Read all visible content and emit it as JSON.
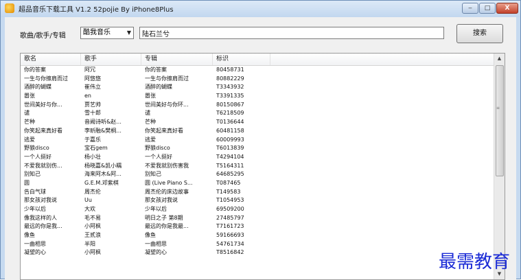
{
  "window": {
    "title": "超品音乐下载工具 V1.2 52pojie By iPhone8Plus",
    "minimize_glyph": "‒",
    "maximize_glyph": "□",
    "close_glyph": "X"
  },
  "search": {
    "label": "歌曲/歌手/专辑",
    "source_selected": "酷我音乐",
    "query_value": "陆石兰兮",
    "button_label": "搜索"
  },
  "table": {
    "columns": [
      "歌名",
      "歌手",
      "专辑",
      "标识"
    ],
    "rows": [
      [
        "你的答案",
        "阿冗",
        "你的答案",
        "80458731"
      ],
      [
        "一生与你擦肩而过",
        "阿悠悠",
        "一生与你擦肩而过",
        "80882229"
      ],
      [
        "酒醉的蝴蝶",
        "崔伟立",
        "酒醉的蝴蝶",
        "T3343932"
      ],
      [
        "嚣张",
        "en",
        "嚣张",
        "T3391335"
      ],
      [
        "世间美好与你...",
        "贾艺帅",
        "世间美好与你环...",
        "80150867"
      ],
      [
        "谴",
        "雪十郎",
        "谴",
        "T6218509"
      ],
      [
        "芒种",
        "音阙诗听&赵...",
        "芒种",
        "T0136644"
      ],
      [
        "你笑起来真好看",
        "李昕融&樊桐...",
        "你笑起来真好看",
        "60481158"
      ],
      [
        "逃爱",
        "于嘉乐",
        "逃爱",
        "60009993"
      ],
      [
        "野狼disco",
        "宝石gem",
        "野狼disco",
        "T6013839"
      ],
      [
        "一个人挺好",
        "杨小壮",
        "一个人挺好",
        "T4294104"
      ],
      [
        "不爱我就别伤...",
        "杨晓嘉&凯小糯",
        "不爱我就别伤害我",
        "T5164311"
      ],
      [
        "别知己",
        "海来阿木&阿...",
        "别知己",
        "64685295"
      ],
      [
        "圆",
        "G.E.M.邓紫棋",
        "圆 (Live Piano S...",
        "T087465"
      ],
      [
        "告白气球",
        "周杰伦",
        "周杰伦的床边故事",
        "T149583"
      ],
      [
        "那女孩对我说",
        "Uu",
        "那女孩对我说",
        "T1054953"
      ],
      [
        "少年以后",
        "大欢",
        "少年以后",
        "69509200"
      ],
      [
        "像我这样的人",
        "毛不易",
        "明日之子 第8期",
        "27485797"
      ],
      [
        "最远的你是我...",
        "小阿枫",
        "最远的你是我最...",
        "T7161723"
      ],
      [
        "像鱼",
        "王贰浪",
        "像鱼",
        "59166693"
      ],
      [
        "一曲相思",
        "半阳",
        "一曲相思",
        "54761734"
      ],
      [
        "凝望的心",
        "小阿枫",
        "凝望的心",
        "T8516842"
      ]
    ]
  },
  "scrollbar": {
    "up_glyph": "▲",
    "down_glyph": "▼",
    "grip_glyph": "≡"
  },
  "watermark": "最需教育"
}
